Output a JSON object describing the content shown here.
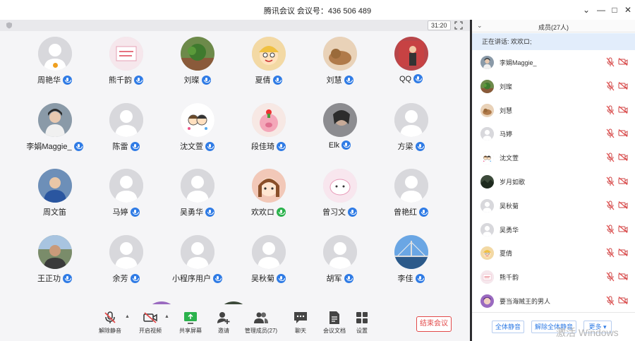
{
  "window": {
    "title": "腾讯会议 会议号：436 506 489",
    "controls": [
      "chevron-down",
      "minimize",
      "maximize",
      "close"
    ]
  },
  "meeting": {
    "timer": "31:20"
  },
  "grid": {
    "members": [
      {
        "name": "周艳华",
        "mic": "blue",
        "avatar": "default",
        "host": true
      },
      {
        "name": "熊千韵",
        "mic": "blue",
        "avatar": "text-card"
      },
      {
        "name": "刘璨",
        "mic": "blue",
        "avatar": "plant"
      },
      {
        "name": "夏倩",
        "mic": "blue",
        "avatar": "cartoon-boy"
      },
      {
        "name": "刘慧",
        "mic": "blue",
        "avatar": "cat"
      },
      {
        "name": "QQ",
        "mic": "blue",
        "avatar": "person-red"
      },
      {
        "name": "李娟Maggie_",
        "mic": "blue",
        "avatar": "person-photo"
      },
      {
        "name": "陈雷",
        "mic": "blue",
        "avatar": "default"
      },
      {
        "name": "沈文萱",
        "mic": "blue",
        "avatar": "couple-cartoon"
      },
      {
        "name": "段佳琦",
        "mic": "blue",
        "avatar": "pig"
      },
      {
        "name": "Elk",
        "mic": "blue",
        "avatar": "selfie"
      },
      {
        "name": "方梁",
        "mic": "blue",
        "avatar": "default"
      },
      {
        "name": "周文笛",
        "mic": "none",
        "avatar": "boy-blue"
      },
      {
        "name": "马婷",
        "mic": "blue",
        "avatar": "default"
      },
      {
        "name": "吴勇华",
        "mic": "blue",
        "avatar": "default"
      },
      {
        "name": "欢欢ロ",
        "mic": "green",
        "avatar": "girl-cartoon"
      },
      {
        "name": "曾习文",
        "mic": "blue",
        "avatar": "pink-doodle"
      },
      {
        "name": "曾艳红",
        "mic": "blue",
        "avatar": "default"
      },
      {
        "name": "王正功",
        "mic": "blue",
        "avatar": "man-photo"
      },
      {
        "name": "余芳",
        "mic": "blue",
        "avatar": "default"
      },
      {
        "name": "小程序用户",
        "mic": "blue",
        "avatar": "default"
      },
      {
        "name": "吴秋菊",
        "mic": "blue",
        "avatar": "default"
      },
      {
        "name": "胡军",
        "mic": "blue",
        "avatar": "default"
      },
      {
        "name": "李佳",
        "mic": "blue",
        "avatar": "bridge"
      }
    ]
  },
  "toolbar": {
    "unmute": "解除静音",
    "start_video": "开启视频",
    "share_screen": "共享屏幕",
    "invite": "邀请",
    "manage_members": "管理成员(27)",
    "chat": "聊天",
    "docs": "会议文档",
    "settings": "设置",
    "end_meeting": "结束会议"
  },
  "panel": {
    "title": "成员(27人)",
    "speaking": "正在讲话: 欢欢ロ;",
    "members": [
      {
        "name": "李娟Maggie_",
        "avatar": "person-photo"
      },
      {
        "name": "刘璨",
        "avatar": "plant"
      },
      {
        "name": "刘慧",
        "avatar": "cat"
      },
      {
        "name": "马婷",
        "avatar": "default"
      },
      {
        "name": "沈文萱",
        "avatar": "couple-cartoon"
      },
      {
        "name": "岁月如歌",
        "avatar": "dark-landscape"
      },
      {
        "name": "吴秋菊",
        "avatar": "default"
      },
      {
        "name": "吴勇华",
        "avatar": "default"
      },
      {
        "name": "夏倩",
        "avatar": "cartoon-boy"
      },
      {
        "name": "熊千韵",
        "avatar": "text-card"
      },
      {
        "name": "要当海贼王的男人",
        "avatar": "anime-purple"
      }
    ],
    "mute_all": "全体静音",
    "unmute_all": "解除全体静音",
    "more": "更多 ▾"
  },
  "watermark": "激活 Windows"
}
